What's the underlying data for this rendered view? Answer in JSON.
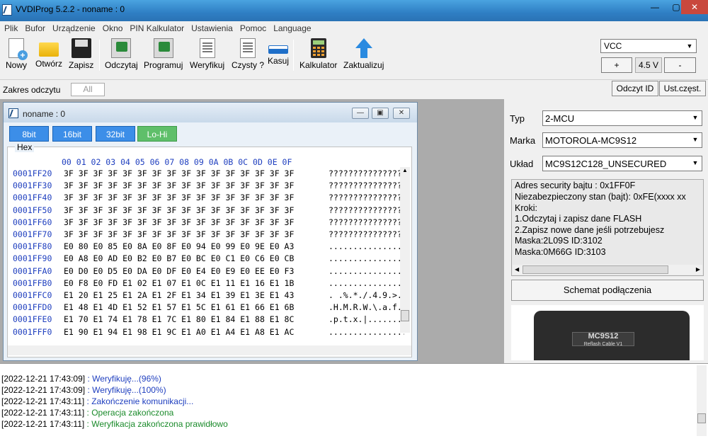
{
  "window": {
    "title": "VVDIProg 5.2.2 - noname : 0",
    "minimize": "—",
    "maximize": "▢",
    "close": "✕"
  },
  "menu": [
    "Plik",
    "Bufor",
    "Urządzenie",
    "Okno",
    "PIN Kalkulator",
    "Ustawienia",
    "Pomoc",
    "Language"
  ],
  "toolbar": {
    "nowy": "Nowy",
    "otworz": "Otwórz",
    "zapisz": "Zapisz",
    "odczytaj": "Odczytaj",
    "programuj": "Programuj",
    "weryfikuj": "Weryfikuj",
    "czysty": "Czysty ?",
    "kasuj": "Kasuj",
    "kalkulator": "Kalkulator",
    "zaktualizuj": "Zaktualizuj"
  },
  "vcc": {
    "selected": "VCC",
    "plus": "+",
    "value": "4.5 V",
    "minus": "-"
  },
  "range": {
    "label": "Zakres odczytu",
    "value": "All",
    "odczyt_id": "Odczyt ID",
    "ust_czest": "Ust.częst."
  },
  "editor": {
    "title": "noname : 0",
    "modes": [
      "8bit",
      "16bit",
      "32bit",
      "Lo-Hi"
    ],
    "group_label": "Hex",
    "header": "00 01 02 03 04 05 06 07 08 09 0A 0B 0C 0D 0E 0F",
    "rows": [
      {
        "addr": "0001FF20",
        "bytes": "3F 3F 3F 3F 3F 3F 3F 3F 3F 3F 3F 3F 3F 3F 3F 3F",
        "ascii": "????????????????"
      },
      {
        "addr": "0001FF30",
        "bytes": "3F 3F 3F 3F 3F 3F 3F 3F 3F 3F 3F 3F 3F 3F 3F 3F",
        "ascii": "????????????????"
      },
      {
        "addr": "0001FF40",
        "bytes": "3F 3F 3F 3F 3F 3F 3F 3F 3F 3F 3F 3F 3F 3F 3F 3F",
        "ascii": "????????????????"
      },
      {
        "addr": "0001FF50",
        "bytes": "3F 3F 3F 3F 3F 3F 3F 3F 3F 3F 3F 3F 3F 3F 3F 3F",
        "ascii": "????????????????"
      },
      {
        "addr": "0001FF60",
        "bytes": "3F 3F 3F 3F 3F 3F 3F 3F 3F 3F 3F 3F 3F 3F 3F 3F",
        "ascii": "????????????????"
      },
      {
        "addr": "0001FF70",
        "bytes": "3F 3F 3F 3F 3F 3F 3F 3F 3F 3F 3F 3F 3F 3F 3F 3F",
        "ascii": "????????????????"
      },
      {
        "addr": "0001FF80",
        "bytes": "E0 80 E0 85 E0 8A E0 8F E0 94 E0 99 E0 9E E0 A3",
        "ascii": "................"
      },
      {
        "addr": "0001FF90",
        "bytes": "E0 A8 E0 AD E0 B2 E0 B7 E0 BC E0 C1 E0 C6 E0 CB",
        "ascii": "................"
      },
      {
        "addr": "0001FFA0",
        "bytes": "E0 D0 E0 D5 E0 DA E0 DF E0 E4 E0 E9 E0 EE E0 F3",
        "ascii": "................"
      },
      {
        "addr": "0001FFB0",
        "bytes": "E0 F8 E0 FD E1 02 E1 07 E1 0C E1 11 E1 16 E1 1B",
        "ascii": "................"
      },
      {
        "addr": "0001FFC0",
        "bytes": "E1 20 E1 25 E1 2A E1 2F E1 34 E1 39 E1 3E E1 43",
        "ascii": ". .%.*./.4.9.>.C"
      },
      {
        "addr": "0001FFD0",
        "bytes": "E1 48 E1 4D E1 52 E1 57 E1 5C E1 61 E1 66 E1 6B",
        "ascii": ".H.M.R.W.\\.a.f.k"
      },
      {
        "addr": "0001FFE0",
        "bytes": "E1 70 E1 74 E1 78 E1 7C E1 80 E1 84 E1 88 E1 8C",
        "ascii": ".p.t.x.|........"
      },
      {
        "addr": "0001FFF0",
        "bytes": "E1 90 E1 94 E1 98 E1 9C E1 A0 E1 A4 E1 A8 E1 AC",
        "ascii": "................"
      }
    ]
  },
  "device": {
    "typ_label": "Typ",
    "typ_value": "2-MCU",
    "marka_label": "Marka",
    "marka_value": "MOTOROLA-MC9S12",
    "uklad_label": "Układ",
    "uklad_value": "MC9S12C128_UNSECURED",
    "info": [
      "Adres security bajtu : 0x1FF0F",
      "Niezabezpieczony stan (bajt): 0xFE(xxxx xx",
      "Kroki:",
      "1.Odczytaj i zapisz dane FLASH",
      "2.Zapisz nowe dane jeśli potrzebujesz",
      "Maska:2L09S ID:3102",
      "Maska:0M66G ID:3103"
    ],
    "schemat": "Schemat podłączenia",
    "chip_title": "MC9S12",
    "chip_sub": "Reflash Cable V1"
  },
  "log": [
    {
      "ts": "[2022-12-21 17:43:09]",
      "msg": " : Weryfikuję...(96%)",
      "color": "#1f3fbf"
    },
    {
      "ts": "[2022-12-21 17:43:09]",
      "msg": " : Weryfikuję...(100%)",
      "color": "#1f3fbf"
    },
    {
      "ts": "[2022-12-21 17:43:11]",
      "msg": " : Zakończenie komunikacji...",
      "color": "#1f3fbf"
    },
    {
      "ts": "[2022-12-21 17:43:11]",
      "msg": " : Operacja zakończona",
      "color": "#1a8a2a"
    },
    {
      "ts": "[2022-12-21 17:43:11]",
      "msg": " : Weryfikacja zakończona prawidłowo",
      "color": "#1a8a2a"
    }
  ],
  "colors": {
    "mode_blue": "#3c8ee8",
    "mode_green": "#5fbf6a",
    "hex_addr": "#1f3fbf"
  }
}
